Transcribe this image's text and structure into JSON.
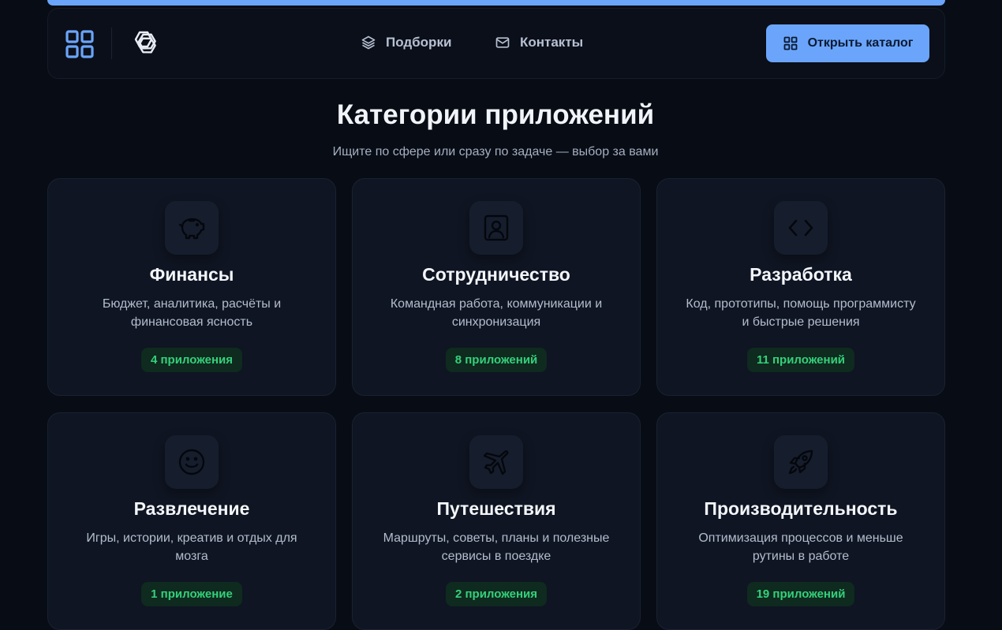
{
  "nav": {
    "links": [
      {
        "label": "Подборки",
        "icon": "layers-icon"
      },
      {
        "label": "Контакты",
        "icon": "mail-icon"
      }
    ],
    "cta_label": "Открыть каталог",
    "cta_icon": "grid-icon"
  },
  "colors": {
    "accent": "#6aa5fb",
    "background": "#080c14",
    "card": "#0f1522",
    "badge_text": "#34d17a",
    "badge_bg": "#0f2a1f"
  },
  "hero": {
    "title": "Категории приложений",
    "subtitle": "Ищите по сфере или сразу по задаче — выбор за вами"
  },
  "categories": [
    {
      "icon": "piggy-bank-icon",
      "title": "Финансы",
      "desc": "Бюджет, аналитика, расчёты и финансовая ясность",
      "count": "4 приложения"
    },
    {
      "icon": "contact-card-icon",
      "title": "Сотрудничество",
      "desc": "Командная работа, коммуникации и синхронизация",
      "count": "8 приложений"
    },
    {
      "icon": "code-icon",
      "title": "Разработка",
      "desc": "Код, прототипы, помощь программисту и быстрые решения",
      "count": "11 приложений"
    },
    {
      "icon": "smile-icon",
      "title": "Развлечение",
      "desc": "Игры, истории, креатив и отдых для мозга",
      "count": "1 приложение"
    },
    {
      "icon": "plane-icon",
      "title": "Путешествия",
      "desc": "Маршруты, советы, планы и полезные сервисы в поездке",
      "count": "2 приложения"
    },
    {
      "icon": "rocket-icon",
      "title": "Производительность",
      "desc": "Оптимизация процессов и меньше рутины в работе",
      "count": "19 приложений"
    }
  ]
}
